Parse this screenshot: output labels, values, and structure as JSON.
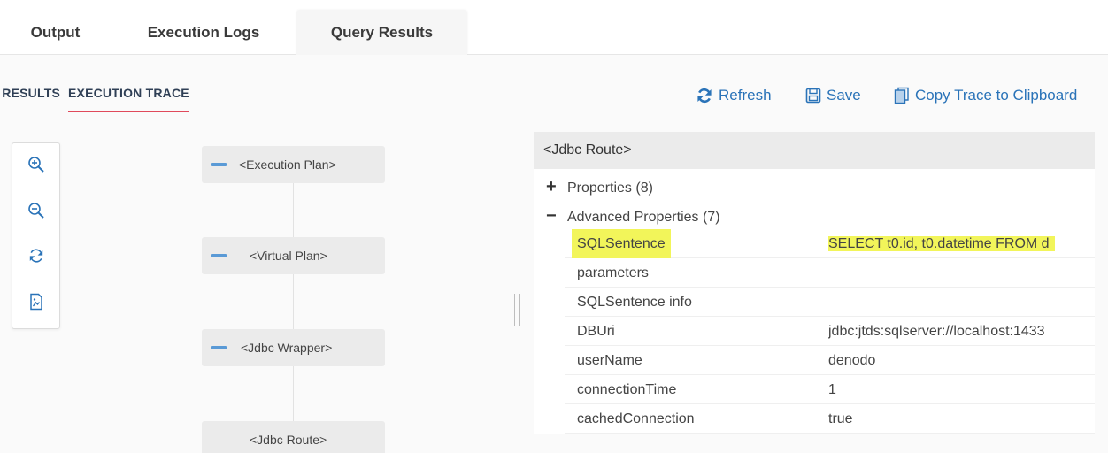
{
  "tabs": {
    "output": "Output",
    "logs": "Execution Logs",
    "query_results": "Query Results"
  },
  "subtabs": {
    "results": "RESULTS",
    "trace": "EXECUTION TRACE"
  },
  "toolbar": {
    "refresh": "Refresh",
    "save": "Save",
    "copy": "Copy Trace to Clipboard"
  },
  "tree": {
    "nodes": [
      {
        "label": "<Execution Plan>",
        "collapsible": true
      },
      {
        "label": "<Virtual Plan>",
        "collapsible": true
      },
      {
        "label": "<Jdbc Wrapper>",
        "collapsible": true
      },
      {
        "label": "<Jdbc Route>",
        "collapsible": false
      }
    ]
  },
  "details": {
    "title": "<Jdbc Route>",
    "groups": [
      {
        "sign": "+",
        "label": "Properties (8)"
      },
      {
        "sign": "−",
        "label": "Advanced Properties (7)"
      }
    ],
    "rows": [
      {
        "key": "SQLSentence",
        "value": "SELECT t0.id, t0.datetime FROM d",
        "highlight": true
      },
      {
        "key": "parameters",
        "value": ""
      },
      {
        "key": "SQLSentence info",
        "value": ""
      },
      {
        "key": "DBUri",
        "value": "jdbc:jtds:sqlserver://localhost:1433"
      },
      {
        "key": "userName",
        "value": "denodo"
      },
      {
        "key": "connectionTime",
        "value": "1"
      },
      {
        "key": "cachedConnection",
        "value": "true"
      }
    ]
  },
  "colors": {
    "accent": "#2a73b8",
    "active_underline": "#e0495b",
    "highlight": "#f2f55a"
  }
}
